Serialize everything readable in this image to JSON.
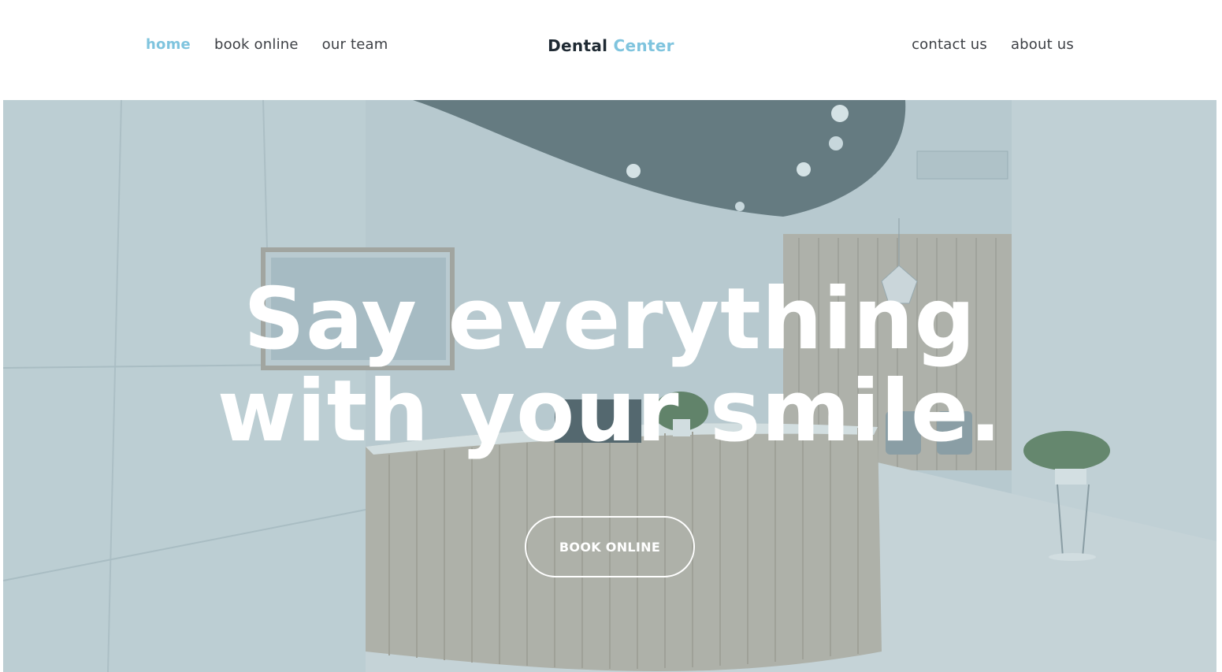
{
  "brand": {
    "name_part1": "Dental",
    "name_part2": "Center",
    "accent_color": "#7fc4de",
    "text_color": "#1f2a33"
  },
  "nav_left": [
    {
      "label": "home",
      "active": true
    },
    {
      "label": "book online",
      "active": false
    },
    {
      "label": "our team",
      "active": false
    }
  ],
  "nav_right": [
    {
      "label": "contact us"
    },
    {
      "label": "about us"
    }
  ],
  "hero": {
    "headline_line1": "Say everything",
    "headline_line2": "with your smile.",
    "cta_label": "BOOK ONLINE",
    "image_description_icon": "dental-reception-photo"
  }
}
